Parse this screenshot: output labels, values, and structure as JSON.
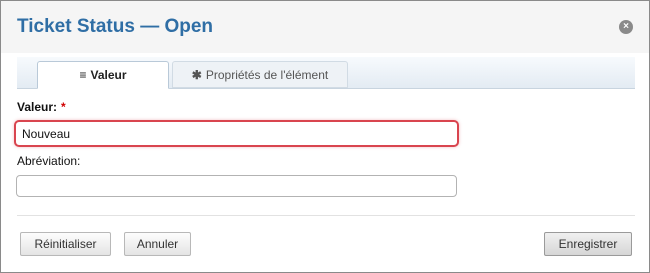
{
  "dialog": {
    "title": "Ticket Status — Open",
    "close_icon": "close-circle-icon"
  },
  "tabs": [
    {
      "label": "Valeur",
      "icon": "≡",
      "icon_name": "list-icon",
      "active": true
    },
    {
      "label": "Propriétés de l'élément",
      "icon": "✱",
      "icon_name": "asterisk-icon",
      "active": false
    }
  ],
  "form": {
    "valeur_label": "Valeur:",
    "required_mark": "*",
    "valeur_value": "Nouveau",
    "abreviation_label": "Abréviation:",
    "abreviation_value": ""
  },
  "buttons": {
    "reset_label": "Réinitialiser",
    "cancel_label": "Annuler",
    "save_label": "Enregistrer"
  },
  "colors": {
    "title": "#2f6ea5",
    "error_border": "#d9454f",
    "required": "#d00000"
  }
}
